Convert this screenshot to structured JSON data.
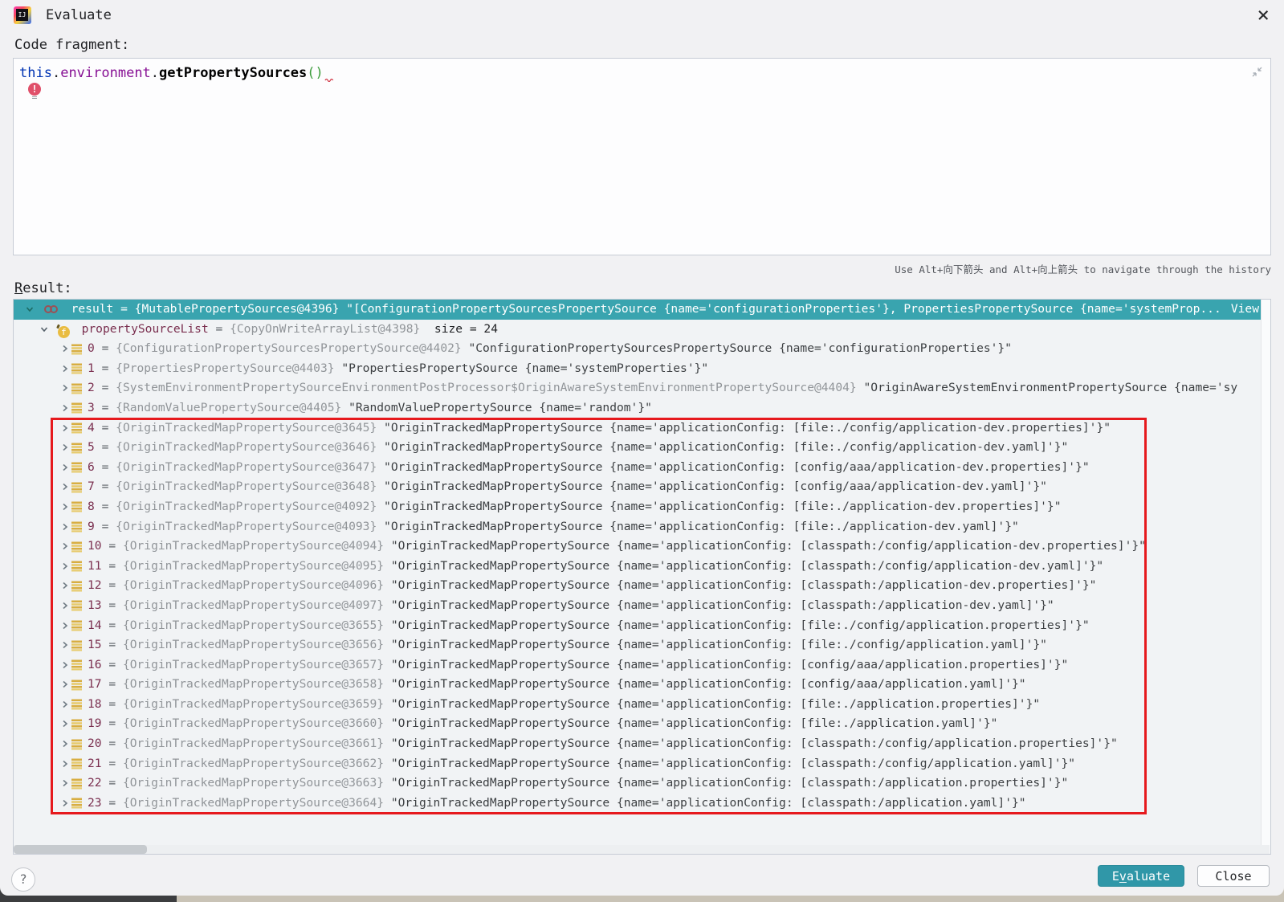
{
  "window": {
    "title": "Evaluate",
    "close_glyph": "×"
  },
  "code_fragment": {
    "label": "Code fragment:",
    "tokens": [
      {
        "text": "this",
        "style": "keyword"
      },
      {
        "text": ".",
        "style": "plain"
      },
      {
        "text": "environment",
        "style": "field"
      },
      {
        "text": ".",
        "style": "plain"
      },
      {
        "text": "getPropertySources",
        "style": "method"
      },
      {
        "text": "()",
        "style": "paren"
      }
    ],
    "error_badge": "!"
  },
  "hint": {
    "text": "Use Alt+向下箭头 and Alt+向上箭头 to navigate through the history"
  },
  "result": {
    "label": "Result:",
    "separator": " = ",
    "selected": {
      "text": "result = {MutablePropertySources@4396} \"[ConfigurationPropertySourcesPropertySource {name='configurationProperties'}, PropertiesPropertySource {name='systemProp...",
      "view_link": "View"
    },
    "list_header": {
      "name": "propertySourceList",
      "ref": "{CopyOnWriteArrayList@4398}",
      "size": "size = 24"
    },
    "items": [
      {
        "index": "0",
        "ref": "{ConfigurationPropertySourcesPropertySource@4402}",
        "value": "\"ConfigurationPropertySourcesPropertySource {name='configurationProperties'}\""
      },
      {
        "index": "1",
        "ref": "{PropertiesPropertySource@4403}",
        "value": "\"PropertiesPropertySource {name='systemProperties'}\""
      },
      {
        "index": "2",
        "ref": "{SystemEnvironmentPropertySourceEnvironmentPostProcessor$OriginAwareSystemEnvironmentPropertySource@4404}",
        "value": "\"OriginAwareSystemEnvironmentPropertySource {name='sy"
      },
      {
        "index": "3",
        "ref": "{RandomValuePropertySource@4405}",
        "value": "\"RandomValuePropertySource {name='random'}\""
      },
      {
        "index": "4",
        "ref": "{OriginTrackedMapPropertySource@3645}",
        "value": "\"OriginTrackedMapPropertySource {name='applicationConfig: [file:./config/application-dev.properties]'}\""
      },
      {
        "index": "5",
        "ref": "{OriginTrackedMapPropertySource@3646}",
        "value": "\"OriginTrackedMapPropertySource {name='applicationConfig: [file:./config/application-dev.yaml]'}\""
      },
      {
        "index": "6",
        "ref": "{OriginTrackedMapPropertySource@3647}",
        "value": "\"OriginTrackedMapPropertySource {name='applicationConfig: [config/aaa/application-dev.properties]'}\""
      },
      {
        "index": "7",
        "ref": "{OriginTrackedMapPropertySource@3648}",
        "value": "\"OriginTrackedMapPropertySource {name='applicationConfig: [config/aaa/application-dev.yaml]'}\""
      },
      {
        "index": "8",
        "ref": "{OriginTrackedMapPropertySource@4092}",
        "value": "\"OriginTrackedMapPropertySource {name='applicationConfig: [file:./application-dev.properties]'}\""
      },
      {
        "index": "9",
        "ref": "{OriginTrackedMapPropertySource@4093}",
        "value": "\"OriginTrackedMapPropertySource {name='applicationConfig: [file:./application-dev.yaml]'}\""
      },
      {
        "index": "10",
        "ref": "{OriginTrackedMapPropertySource@4094}",
        "value": "\"OriginTrackedMapPropertySource {name='applicationConfig: [classpath:/config/application-dev.properties]'}\""
      },
      {
        "index": "11",
        "ref": "{OriginTrackedMapPropertySource@4095}",
        "value": "\"OriginTrackedMapPropertySource {name='applicationConfig: [classpath:/config/application-dev.yaml]'}\""
      },
      {
        "index": "12",
        "ref": "{OriginTrackedMapPropertySource@4096}",
        "value": "\"OriginTrackedMapPropertySource {name='applicationConfig: [classpath:/application-dev.properties]'}\""
      },
      {
        "index": "13",
        "ref": "{OriginTrackedMapPropertySource@4097}",
        "value": "\"OriginTrackedMapPropertySource {name='applicationConfig: [classpath:/application-dev.yaml]'}\""
      },
      {
        "index": "14",
        "ref": "{OriginTrackedMapPropertySource@3655}",
        "value": "\"OriginTrackedMapPropertySource {name='applicationConfig: [file:./config/application.properties]'}\""
      },
      {
        "index": "15",
        "ref": "{OriginTrackedMapPropertySource@3656}",
        "value": "\"OriginTrackedMapPropertySource {name='applicationConfig: [file:./config/application.yaml]'}\""
      },
      {
        "index": "16",
        "ref": "{OriginTrackedMapPropertySource@3657}",
        "value": "\"OriginTrackedMapPropertySource {name='applicationConfig: [config/aaa/application.properties]'}\""
      },
      {
        "index": "17",
        "ref": "{OriginTrackedMapPropertySource@3658}",
        "value": "\"OriginTrackedMapPropertySource {name='applicationConfig: [config/aaa/application.yaml]'}\""
      },
      {
        "index": "18",
        "ref": "{OriginTrackedMapPropertySource@3659}",
        "value": "\"OriginTrackedMapPropertySource {name='applicationConfig: [file:./application.properties]'}\""
      },
      {
        "index": "19",
        "ref": "{OriginTrackedMapPropertySource@3660}",
        "value": "\"OriginTrackedMapPropertySource {name='applicationConfig: [file:./application.yaml]'}\""
      },
      {
        "index": "20",
        "ref": "{OriginTrackedMapPropertySource@3661}",
        "value": "\"OriginTrackedMapPropertySource {name='applicationConfig: [classpath:/config/application.properties]'}\""
      },
      {
        "index": "21",
        "ref": "{OriginTrackedMapPropertySource@3662}",
        "value": "\"OriginTrackedMapPropertySource {name='applicationConfig: [classpath:/config/application.yaml]'}\""
      },
      {
        "index": "22",
        "ref": "{OriginTrackedMapPropertySource@3663}",
        "value": "\"OriginTrackedMapPropertySource {name='applicationConfig: [classpath:/application.properties]'}\""
      },
      {
        "index": "23",
        "ref": "{OriginTrackedMapPropertySource@3664}",
        "value": "\"OriginTrackedMapPropertySource {name='applicationConfig: [classpath:/application.yaml]'}\""
      }
    ]
  },
  "buttons": {
    "help": "?",
    "evaluate": "Evaluate",
    "evaluate_mnemonic": "v",
    "close": "Close"
  },
  "colors": {
    "selection": "#39a4af",
    "accent_button": "#3097a8",
    "annotation": "#e6191d",
    "index_text": "#7a2f4f",
    "ref_text": "#919599"
  }
}
